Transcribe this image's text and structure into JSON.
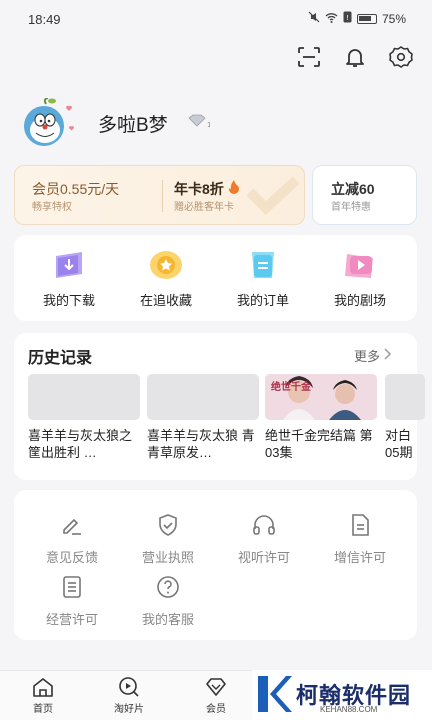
{
  "status_bar": {
    "time": "18:49",
    "battery": "75%"
  },
  "top_icons": [
    "scan-icon",
    "bell-icon",
    "gear-icon"
  ],
  "profile": {
    "name": "多啦B梦",
    "level_badge": "1"
  },
  "vip": {
    "item1": {
      "title": "会员0.55元/天",
      "subtitle": "畅享特权"
    },
    "item2": {
      "title": "年卡8折",
      "subtitle": "赠必胜客年卡"
    },
    "item3": {
      "title": "立减60",
      "subtitle": "首年特惠"
    }
  },
  "quick_actions": [
    {
      "label": "我的下载",
      "icon": "download-icon",
      "color": "#a58af0"
    },
    {
      "label": "在追收藏",
      "icon": "star-icon",
      "color": "#f6b93b"
    },
    {
      "label": "我的订单",
      "icon": "order-icon",
      "color": "#5cc9f0"
    },
    {
      "label": "我的剧场",
      "icon": "play-icon",
      "color": "#f08ac0"
    }
  ],
  "history": {
    "title": "历史记录",
    "more": "更多",
    "items": [
      {
        "text": "喜羊羊与灰太狼之筐出胜利 …"
      },
      {
        "text": "喜羊羊与灰太狼 青青草原发…"
      },
      {
        "text": "绝世千金完结篇 第03集",
        "poster_text": "绝世千金"
      },
      {
        "text": "对白05期"
      }
    ]
  },
  "services": [
    {
      "label": "意见反馈",
      "icon": "pen-icon"
    },
    {
      "label": "营业执照",
      "icon": "shield-check-icon"
    },
    {
      "label": "视听许可",
      "icon": "headphones-icon"
    },
    {
      "label": "增信许可",
      "icon": "document-icon"
    },
    {
      "label": "经营许可",
      "icon": "list-doc-icon"
    },
    {
      "label": "我的客服",
      "icon": "question-icon"
    }
  ],
  "bottom_nav": [
    {
      "label": "首页",
      "icon": "home-icon"
    },
    {
      "label": "淘好片",
      "icon": "discover-icon"
    },
    {
      "label": "会员",
      "icon": "vip-diamond-icon"
    }
  ],
  "watermark": {
    "text": "柯翰软件园",
    "sub": "KEHAN88.COM"
  }
}
